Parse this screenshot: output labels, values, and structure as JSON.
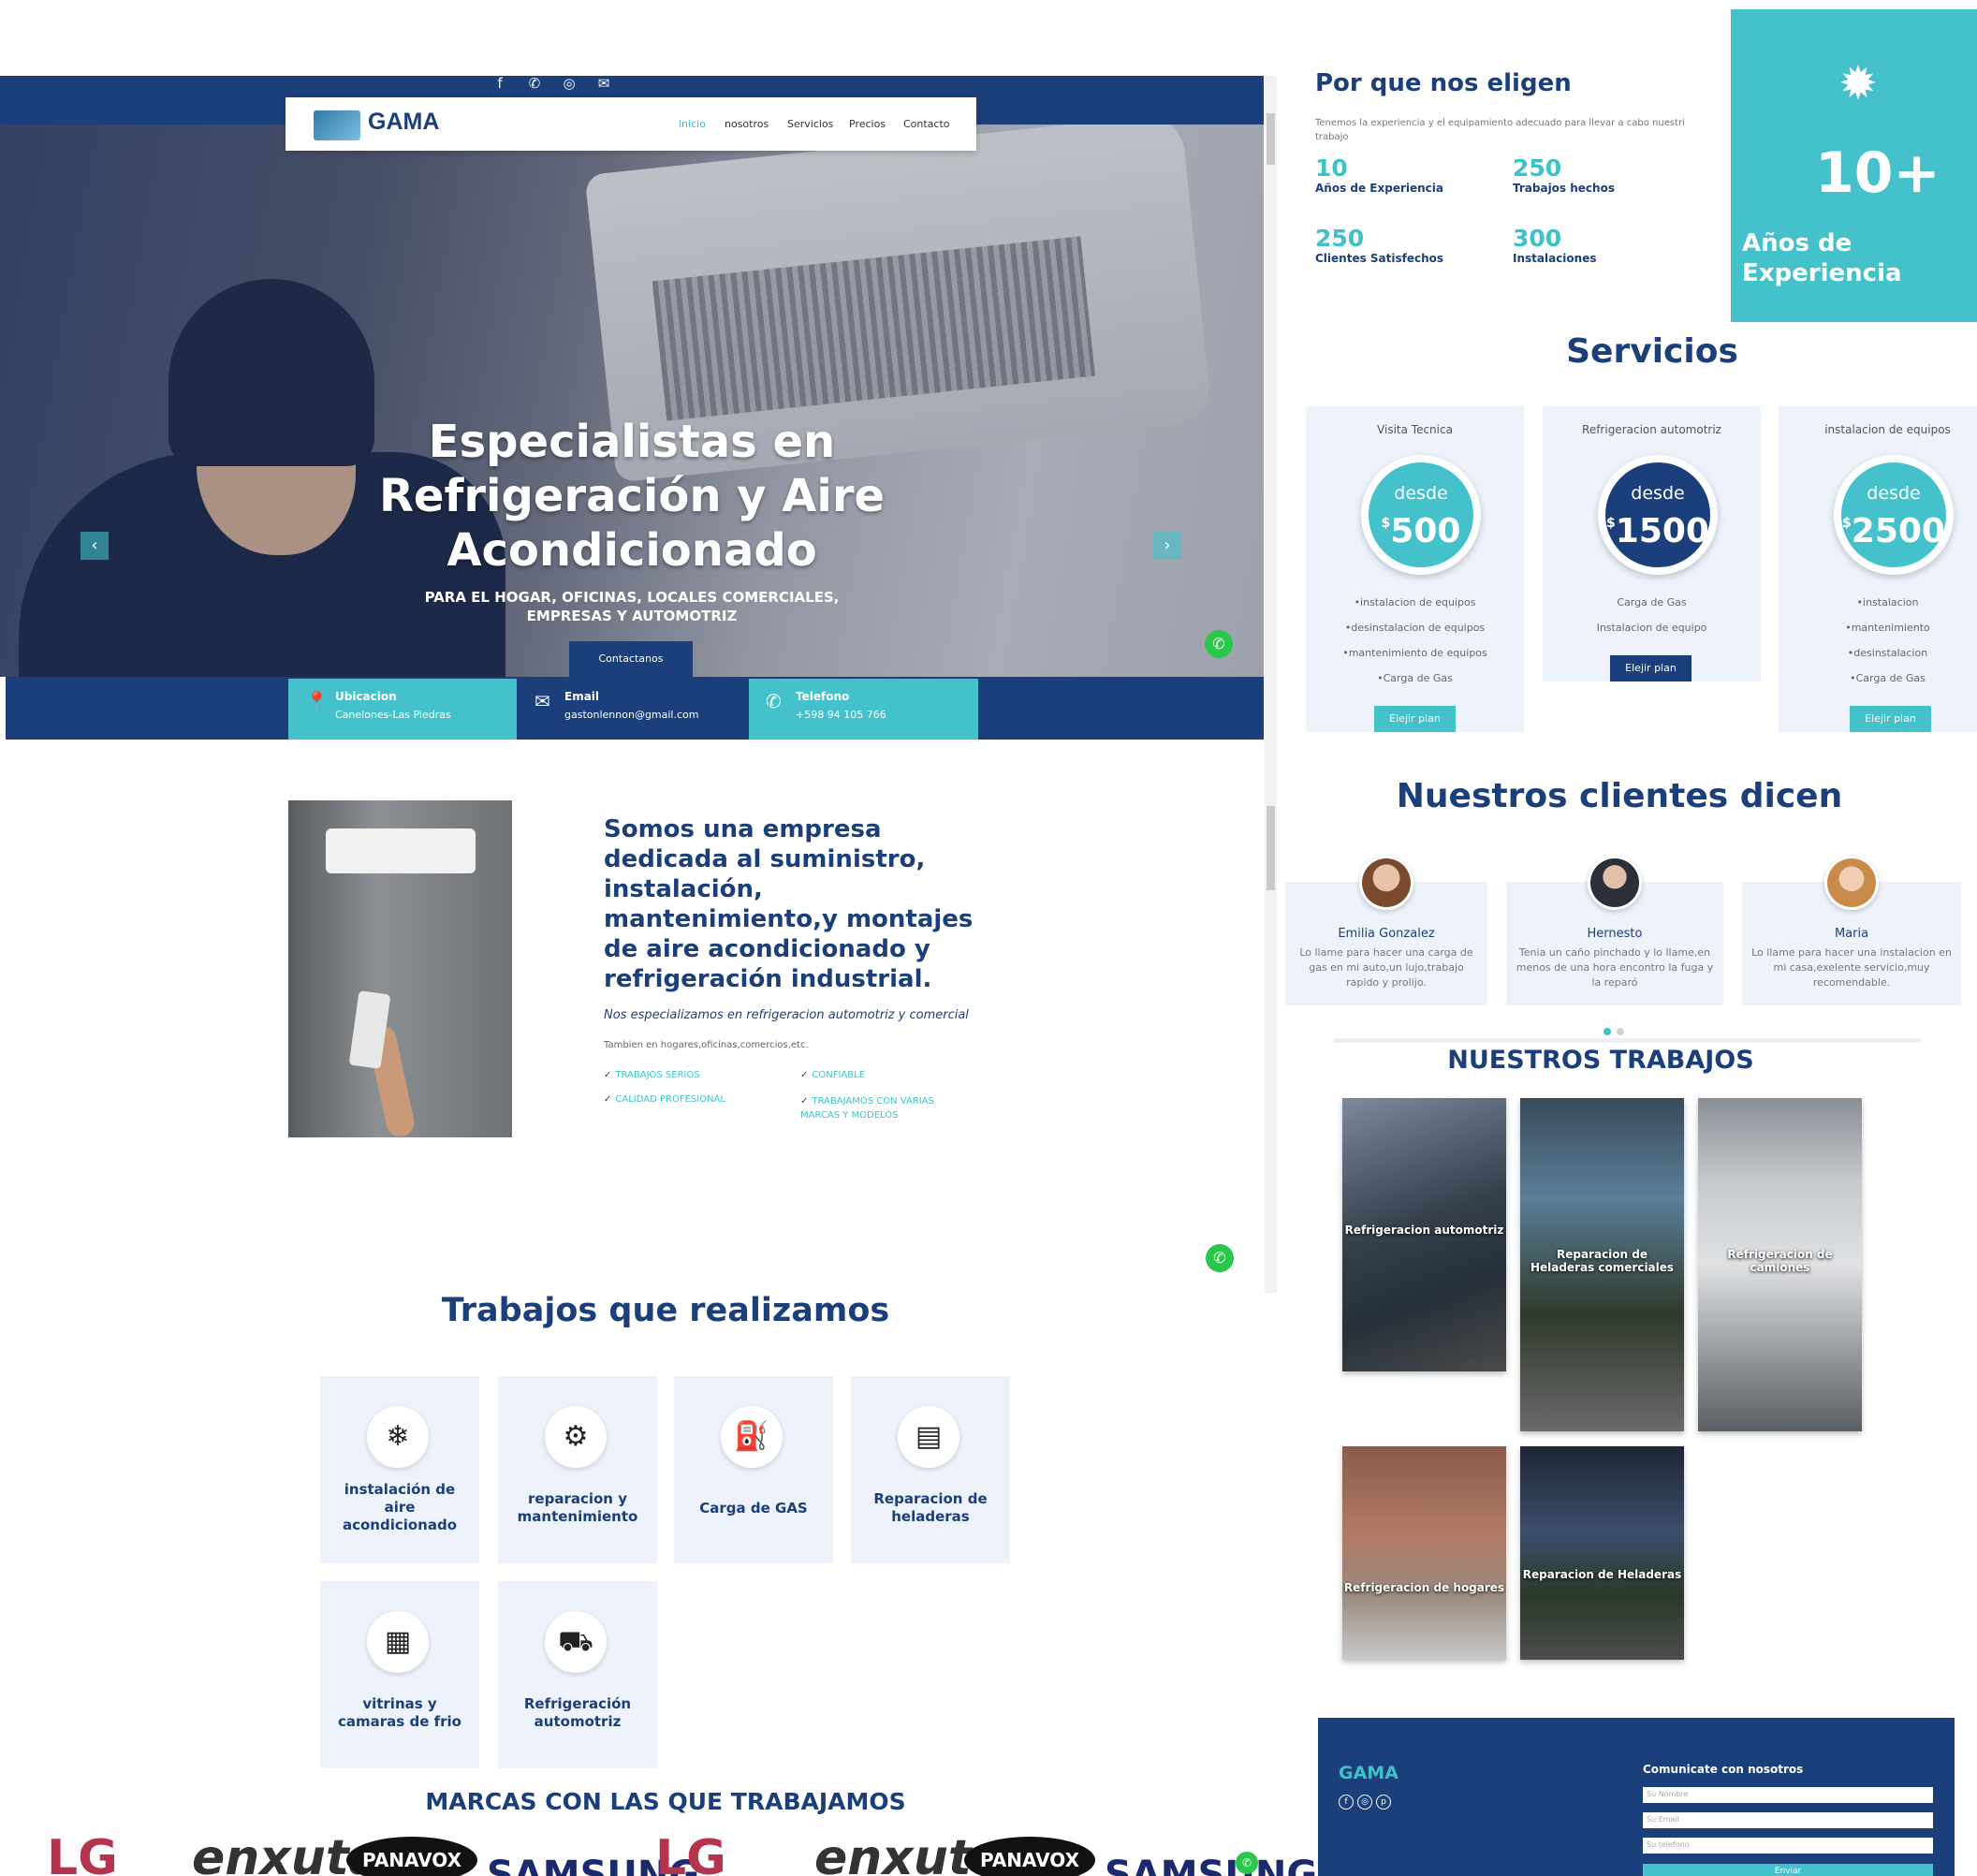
{
  "header": {
    "social_icons": [
      "facebook-icon",
      "whatsapp-icon",
      "instagram-icon",
      "email-icon"
    ],
    "logo_text": "GAMA",
    "nav": [
      "inicio",
      "nosotros",
      "Servicios",
      "Precios",
      "Contacto"
    ]
  },
  "hero": {
    "title": "Especialistas en Refrigeración y Aire Acondicionado",
    "subtitle": "PARA EL HOGAR, OFICINAS, LOCALES COMERCIALES, EMPRESAS Y AUTOMOTRIZ",
    "button": "Contactanos"
  },
  "info": [
    {
      "title": "Ubicacion",
      "value": "Canelones-Las Piedras",
      "icon": "location-pin-icon"
    },
    {
      "title": "Email",
      "value": "gastonlennon@gmail.com",
      "icon": "envelope-icon"
    },
    {
      "title": "Telefono",
      "value": "+598 94 105 766",
      "icon": "phone-icon"
    }
  ],
  "about": {
    "title": "Somos una empresa dedicada al suministro, instalación, mantenimiento,y montajes de aire acondicionado y refrigeración industrial.",
    "subtitle": "Nos especializamos en refrigeracion automotriz y comercial",
    "small": "Tambien en hogares,oficinas,comercios,etc.",
    "checks": [
      "TRABAJOS SERIOS",
      "CONFIABLE",
      "CALIDAD PROFESIONAL",
      "TRABAJAMOS CON VARIAS MARCAS Y MODELOS"
    ]
  },
  "trabajos": {
    "title": "Trabajos que realizamos",
    "items": [
      {
        "label": "instalación de aire acondicionado",
        "icon": "air-conditioner-icon"
      },
      {
        "label": "reparacion y mantenimiento",
        "icon": "ac-repair-icon"
      },
      {
        "label": "Carga de GAS",
        "icon": "gas-cylinder-icon"
      },
      {
        "label": "Reparacion de heladeras",
        "icon": "fridge-icon"
      },
      {
        "label": "vitrinas y camaras de frio",
        "icon": "display-fridge-icon"
      },
      {
        "label": "Refrigeración automotriz",
        "icon": "truck-icon"
      }
    ]
  },
  "marcas": {
    "title": "MARCAS CON LAS QUE TRABAJAMOS",
    "brands": [
      "LG",
      "enxuta",
      "PANAVOX",
      "SAMSUNG",
      "LG",
      "enxuta",
      "PANAVOX",
      "SAMSUNG"
    ]
  },
  "porque": {
    "title": "Por que nos eligen",
    "text": "Tenemos la experiencia y el equipamiento adecuado para llevar a cabo nuestri trabajo",
    "stats": [
      {
        "n": "10",
        "l": "Años de Experiencia"
      },
      {
        "n": "250",
        "l": "Trabajos hechos"
      },
      {
        "n": "250",
        "l": "Clientes Satisfechos"
      },
      {
        "n": "300",
        "l": "Instalaciones"
      }
    ],
    "badge_num": "10+",
    "badge_label": "Años de Experiencia"
  },
  "servicios": {
    "title": "Servicios",
    "plans": [
      {
        "name": "Visita Tecnica",
        "desde": "desde",
        "currency": "$",
        "price": "500",
        "features": [
          "•instalacion de equipos",
          "•desinstalacion de equipos",
          "•mantenimiento de equipos",
          "•Carga de Gas"
        ],
        "button": "Elejir plan",
        "color": "#45c1cb"
      },
      {
        "name": "Refrigeracion automotriz",
        "desde": "desde",
        "currency": "$",
        "price": "1500",
        "features": [
          "Carga de Gas",
          "Instalacion de equipo"
        ],
        "button": "Elejir plan",
        "color": "#1b3f7a"
      },
      {
        "name": "instalacion de equipos",
        "desde": "desde",
        "currency": "$",
        "price": "2500",
        "features": [
          "•instalacion",
          "•mantenimiento",
          "•desinstalacion",
          "•Carga de Gas"
        ],
        "button": "Elejir plan",
        "color": "#45c1cb"
      }
    ]
  },
  "clientes": {
    "title": "Nuestros clientes dicen",
    "items": [
      {
        "name": "Emilia Gonzalez",
        "quote": "Lo llame para hacer una carga de gas en mi auto,un lujo,trabajo rapido y prolijo."
      },
      {
        "name": "Hernesto",
        "quote": "Tenia un caño pinchado y lo llame,en menos de una hora encontro la fuga y la reparó"
      },
      {
        "name": "Maria",
        "quote": "Lo llame para hacer una instalacion en mi casa,exelente servicio,muy recomendable."
      }
    ]
  },
  "nuestros": {
    "title": "NUESTROS TRABAJOS",
    "photos": [
      "Refrigeracion automotriz",
      "Reparacion de Heladeras comerciales",
      "Refrigeracion de camiones",
      "Refrigeracion de hogares",
      "Reparacion de Heladeras"
    ]
  },
  "footer": {
    "logo": "GAMA",
    "contact_title": "Comunicate con nosotros",
    "placeholders": [
      "Su Nombre",
      "Su Email",
      "Su telefono"
    ],
    "button": "Enviar"
  }
}
